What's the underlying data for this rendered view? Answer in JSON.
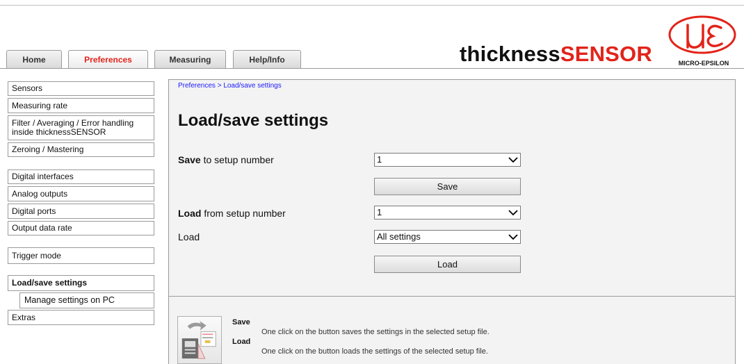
{
  "tabs": [
    {
      "label": "Home",
      "active": false
    },
    {
      "label": "Preferences",
      "active": true
    },
    {
      "label": "Measuring",
      "active": false
    },
    {
      "label": "Help/Info",
      "active": false
    }
  ],
  "brand": {
    "part_a": "thickness",
    "part_b": "SENSOR"
  },
  "logo": {
    "company": "MICRO-EPSILON"
  },
  "sidebar": {
    "items": [
      {
        "label": "Sensors"
      },
      {
        "label": "Measuring rate"
      },
      {
        "label": "Filter / Averaging / Error handling inside thicknessSENSOR"
      },
      {
        "label": "Zeroing / Mastering"
      },
      {
        "label": "Digital interfaces"
      },
      {
        "label": "Analog outputs"
      },
      {
        "label": "Digital ports"
      },
      {
        "label": "Output data rate"
      },
      {
        "label": "Trigger mode"
      },
      {
        "label": "Load/save settings"
      },
      {
        "label": "Manage settings on PC"
      },
      {
        "label": "Extras"
      }
    ]
  },
  "main": {
    "breadcrumb": "Preferences > Load/save settings",
    "title": "Load/save settings",
    "save_row": {
      "label_bold": "Save",
      "label_rest": " to setup number",
      "value": "1"
    },
    "save_button": "Save",
    "load_row": {
      "label_bold": "Load",
      "label_rest": " from setup number",
      "value": "1"
    },
    "load_type": {
      "label": "Load",
      "value": "All settings"
    },
    "load_button": "Load"
  },
  "help": {
    "save_title": "Save",
    "save_desc": "One click on the button saves the settings in the selected setup file.",
    "load_title": "Load",
    "load_desc": "One click on the button loads the settings of the selected setup file."
  },
  "colors": {
    "accent_red": "#e2231a",
    "link_blue": "#1a1aff",
    "panel_bg": "#f3f3f3"
  }
}
